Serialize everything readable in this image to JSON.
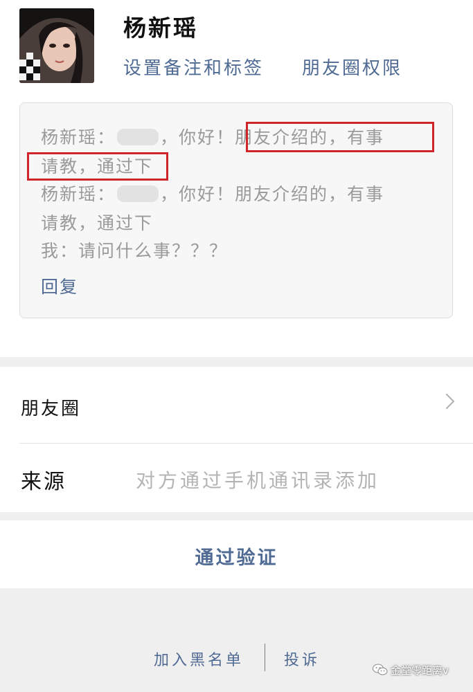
{
  "profile": {
    "name": "杨新瑶",
    "set_remark_label": "设置备注和标签",
    "moments_permission_label": "朋友圈权限"
  },
  "messages": {
    "line1_prefix": "杨新瑶：",
    "line1_greeting": "，你好！",
    "line1_highlight": "朋友介绍的，有事",
    "line2_highlight": "请教，通过下",
    "line3_prefix": "杨新瑶：",
    "line3_rest": "，你好！朋友介绍的，有事",
    "line4": "请教，通过下",
    "line5": "我：请问什么事？？？",
    "reply_label": "回复"
  },
  "moments_row": {
    "label": "朋友圈"
  },
  "source_row": {
    "label": "来源",
    "value": "对方通过手机通讯录添加"
  },
  "actions": {
    "verify_label": "通过验证",
    "blacklist_label": "加入黑名单",
    "complain_label": "投诉"
  },
  "watermark": {
    "text": "金堂零距离v"
  },
  "colors": {
    "link": "#4f6a93",
    "highlight_border": "#d0242b"
  }
}
